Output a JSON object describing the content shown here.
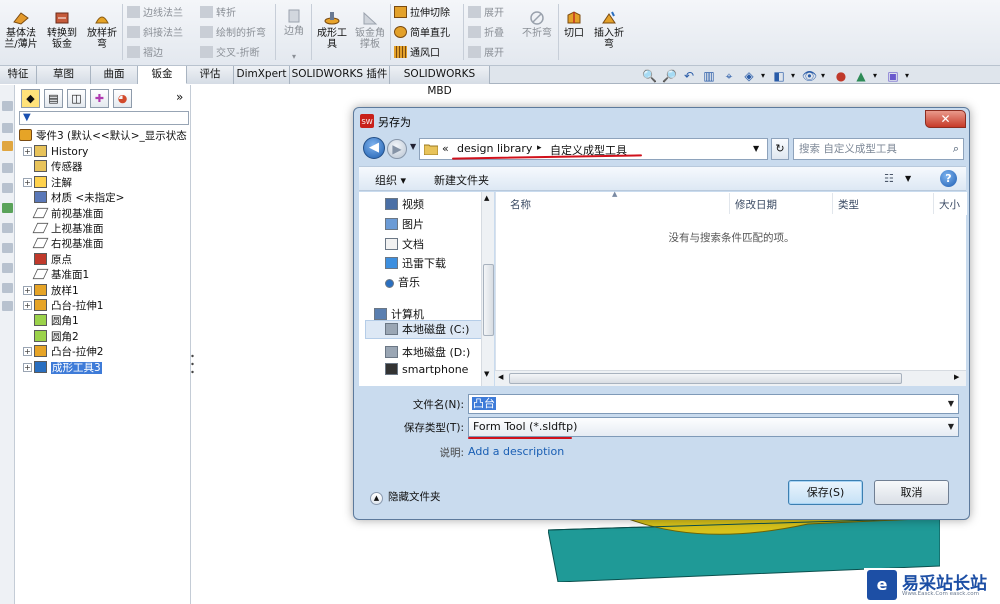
{
  "ribbon": {
    "base_flange": "基体法\n兰/薄片",
    "convert_sheetmetal": "转换到\n钣金",
    "lofted_bend": "放样折\n弯",
    "edge_flange": "边线法兰",
    "miter_flange": "斜接法兰",
    "hem": "褶边",
    "jog": "转折",
    "sketched_bend": "绘制的折弯",
    "cross_break": "交叉-折断",
    "corner": "边角",
    "forming_tool": "成形工\n具",
    "sheetmetal_gusset": "钣金角\n撑板",
    "extruded_cut": "拉伸切除",
    "simple_hole": "简单直孔",
    "vent": "通风口",
    "unfold": "展开",
    "fold": "折叠",
    "flatten": "展开",
    "no_bends": "不折弯",
    "rip": "切口",
    "insert_bends": "插入折\n弯"
  },
  "tabs": [
    "特征",
    "草图",
    "曲面",
    "钣金",
    "评估",
    "DimXpert",
    "SOLIDWORKS 插件",
    "SOLIDWORKS MBD"
  ],
  "tree": {
    "root": "零件3 (默认<<默认>_显示状态",
    "items": [
      {
        "label": "History",
        "icon": "history-icon"
      },
      {
        "label": "传感器",
        "icon": "sensor-icon"
      },
      {
        "label": "注解",
        "icon": "annotation-icon"
      },
      {
        "label": "材质 <未指定>",
        "icon": "material-icon"
      },
      {
        "label": "前视基准面",
        "icon": "plane-icon"
      },
      {
        "label": "上视基准面",
        "icon": "plane-icon"
      },
      {
        "label": "右视基准面",
        "icon": "plane-icon"
      },
      {
        "label": "原点",
        "icon": "origin-icon"
      },
      {
        "label": "基准面1",
        "icon": "plane-icon"
      },
      {
        "label": "放样1",
        "icon": "loft-icon"
      },
      {
        "label": "凸台-拉伸1",
        "icon": "extrude-icon"
      },
      {
        "label": "圆角1",
        "icon": "fillet-icon"
      },
      {
        "label": "圆角2",
        "icon": "fillet-icon"
      },
      {
        "label": "凸台-拉伸2",
        "icon": "extrude-icon"
      },
      {
        "label": "成形工具3",
        "icon": "forming-tool-icon"
      }
    ]
  },
  "dialog": {
    "title": "另存为",
    "close": "✕",
    "breadcrumb": {
      "prefix": "«",
      "seg1": "design library",
      "sep": "▸",
      "seg2": "自定义成型工具"
    },
    "search_placeholder": "搜索 自定义成型工具",
    "toolbar": {
      "organize": "组织 ▾",
      "new_folder": "新建文件夹"
    },
    "nav_items": [
      {
        "label": "视频",
        "icon": "video-icon"
      },
      {
        "label": "图片",
        "icon": "picture-icon"
      },
      {
        "label": "文档",
        "icon": "document-icon"
      },
      {
        "label": "迅雷下载",
        "icon": "download-icon"
      },
      {
        "label": "音乐",
        "icon": "music-icon"
      },
      {
        "label": "计算机",
        "icon": "computer-icon"
      },
      {
        "label": "本地磁盘 (C:)",
        "icon": "drive-icon"
      },
      {
        "label": "本地磁盘 (D:)",
        "icon": "drive-icon"
      },
      {
        "label": "smartphone",
        "icon": "phone-icon"
      }
    ],
    "columns": [
      "名称",
      "修改日期",
      "类型",
      "大小"
    ],
    "empty_message": "没有与搜索条件匹配的项。",
    "filename_label": "文件名(N):",
    "filename_value": "凸台",
    "filetype_label": "保存类型(T):",
    "filetype_value": "Form Tool (*.sldftp)",
    "desc_label": "说明:",
    "desc_link": "Add a description",
    "hide_folders": "隐藏文件夹",
    "save": "保存(S)",
    "cancel": "取消"
  },
  "watermark": {
    "logo": "e",
    "text": "易采站长站",
    "sub": "Www.Easck.Com easck.com"
  }
}
